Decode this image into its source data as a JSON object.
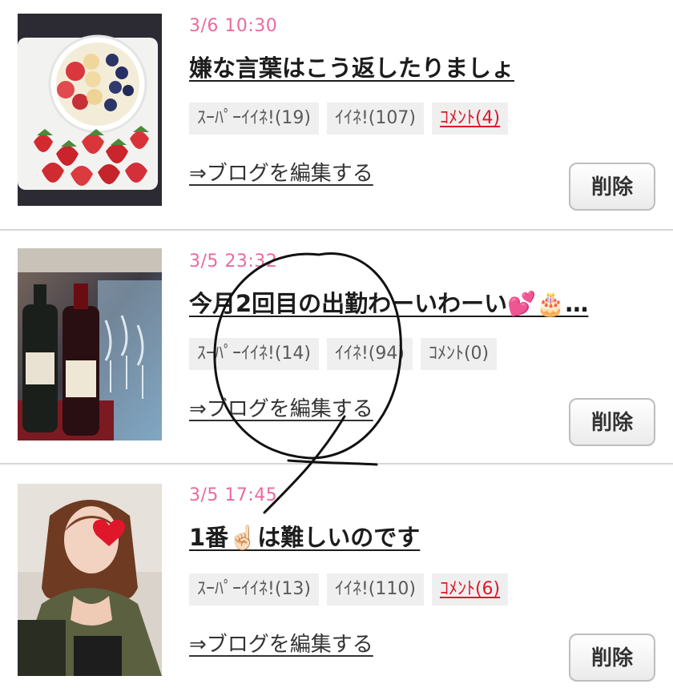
{
  "posts": [
    {
      "date": "3/6 10:30",
      "title": "嫌な言葉はこう返したりましょ",
      "tags": [
        {
          "label": "ｽｰﾊﾟｰｲｲﾈ!(19)",
          "active": false
        },
        {
          "label": "ｲｲﾈ!(107)",
          "active": false
        },
        {
          "label": "ｺﾒﾝﾄ(4)",
          "active": true
        }
      ],
      "edit_label": "⇒ブログを編集する",
      "delete_label": "削除",
      "thumbnail": "fruit-bowl-photo"
    },
    {
      "date": "3/5 23:32",
      "title": "今月2回目の出勤わーいわーい💕🎂…",
      "tags": [
        {
          "label": "ｽｰﾊﾟｰｲｲﾈ!(14)",
          "active": false
        },
        {
          "label": "ｲｲﾈ!(94)",
          "active": false
        },
        {
          "label": "ｺﾒﾝﾄ(0)",
          "active": false
        }
      ],
      "edit_label": "⇒ブログを編集する",
      "delete_label": "削除",
      "thumbnail": "wine-bottles-photo"
    },
    {
      "date": "3/5 17:45",
      "title": "1番☝🏻は難しいのです",
      "tags": [
        {
          "label": "ｽｰﾊﾟｰｲｲﾈ!(13)",
          "active": false
        },
        {
          "label": "ｲｲﾈ!(110)",
          "active": false
        },
        {
          "label": "ｺﾒﾝﾄ(6)",
          "active": true
        }
      ],
      "edit_label": "⇒ブログを編集する",
      "delete_label": "削除",
      "thumbnail": "selfie-photo"
    }
  ],
  "colors": {
    "date": "#e96aa0",
    "comment_active": "#e0162b",
    "tag_bg": "#efefef"
  }
}
